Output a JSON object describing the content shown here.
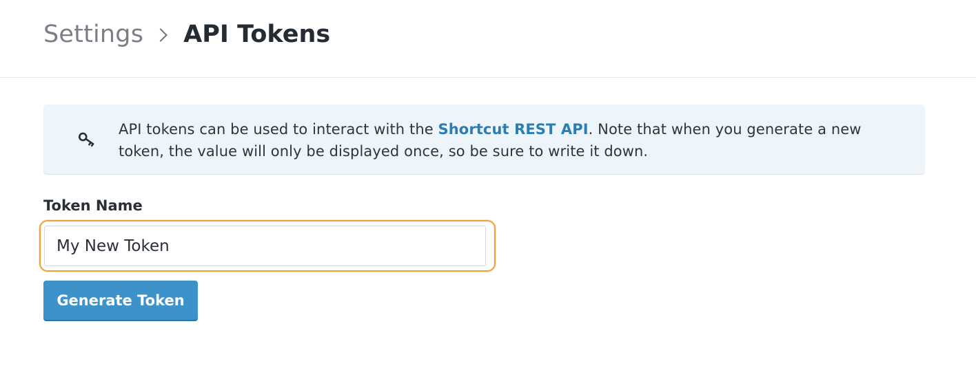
{
  "header": {
    "breadcrumb_parent": "Settings",
    "breadcrumb_current": "API Tokens"
  },
  "info": {
    "icon": "key-icon",
    "text_before": "API tokens can be used to interact with the ",
    "link_text": "Shortcut REST API",
    "text_after": ". Note that when you generate a new token, the value will only be displayed once, so be sure to write it down."
  },
  "form": {
    "label": "Token Name",
    "input_value": "My New Token",
    "button_label": "Generate Token"
  },
  "colors": {
    "link": "#2b7db3",
    "button": "#3d93c9",
    "focus_ring": "#f0a035",
    "info_bg": "#edf5fa"
  }
}
